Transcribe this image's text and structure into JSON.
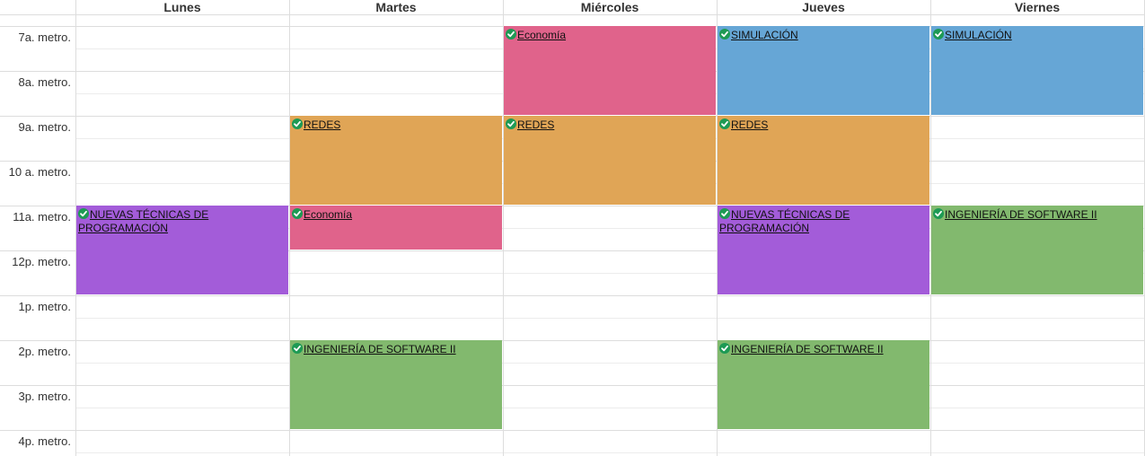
{
  "days": [
    "Lunes",
    "Martes",
    "Miércoles",
    "Jueves",
    "Viernes"
  ],
  "times": [
    "7a. metro.",
    "8a. metro.",
    "9a. metro.",
    "10 a. metro.",
    "11a. metro.",
    "12p. metro.",
    "1p. metro.",
    "2p. metro.",
    "3p. metro.",
    "4p. metro."
  ],
  "colors": {
    "economia": "#e0638b",
    "simulacion": "#66a6d6",
    "redes": "#e0a556",
    "nuevas": "#a35cd9",
    "software": "#82b96e",
    "check": "#1d9a54"
  },
  "events": [
    {
      "day": 2,
      "start": 0,
      "end": 2,
      "title": "Economía",
      "color": "economia",
      "icon": "check-circle-icon"
    },
    {
      "day": 3,
      "start": 0,
      "end": 2,
      "title": "SIMULACIÓN",
      "color": "simulacion",
      "icon": "check-circle-icon"
    },
    {
      "day": 4,
      "start": 0,
      "end": 2,
      "title": "SIMULACIÓN",
      "color": "simulacion",
      "icon": "check-circle-icon"
    },
    {
      "day": 1,
      "start": 2,
      "end": 4,
      "title": "REDES",
      "color": "redes",
      "icon": "check-circle-icon"
    },
    {
      "day": 2,
      "start": 2,
      "end": 4,
      "title": "REDES",
      "color": "redes",
      "icon": "check-circle-icon"
    },
    {
      "day": 3,
      "start": 2,
      "end": 4,
      "title": "REDES",
      "color": "redes",
      "icon": "check-circle-icon"
    },
    {
      "day": 0,
      "start": 4,
      "end": 6,
      "title": "NUEVAS TÉCNICAS DE PROGRAMACIÓN",
      "color": "nuevas",
      "icon": "check-circle-icon"
    },
    {
      "day": 1,
      "start": 4,
      "end": 5,
      "title": "Economía",
      "color": "economia",
      "icon": "check-circle-icon"
    },
    {
      "day": 3,
      "start": 4,
      "end": 6,
      "title": "NUEVAS TÉCNICAS DE PROGRAMACIÓN",
      "color": "nuevas",
      "icon": "check-circle-icon"
    },
    {
      "day": 4,
      "start": 4,
      "end": 6,
      "title": "INGENIERÍA DE SOFTWARE II",
      "color": "software",
      "icon": "check-circle-icon"
    },
    {
      "day": 1,
      "start": 7,
      "end": 9,
      "title": "INGENIERÍA DE SOFTWARE II",
      "color": "software",
      "icon": "check-circle-icon"
    },
    {
      "day": 3,
      "start": 7,
      "end": 9,
      "title": "INGENIERÍA DE SOFTWARE II",
      "color": "software",
      "icon": "check-circle-icon"
    }
  ]
}
